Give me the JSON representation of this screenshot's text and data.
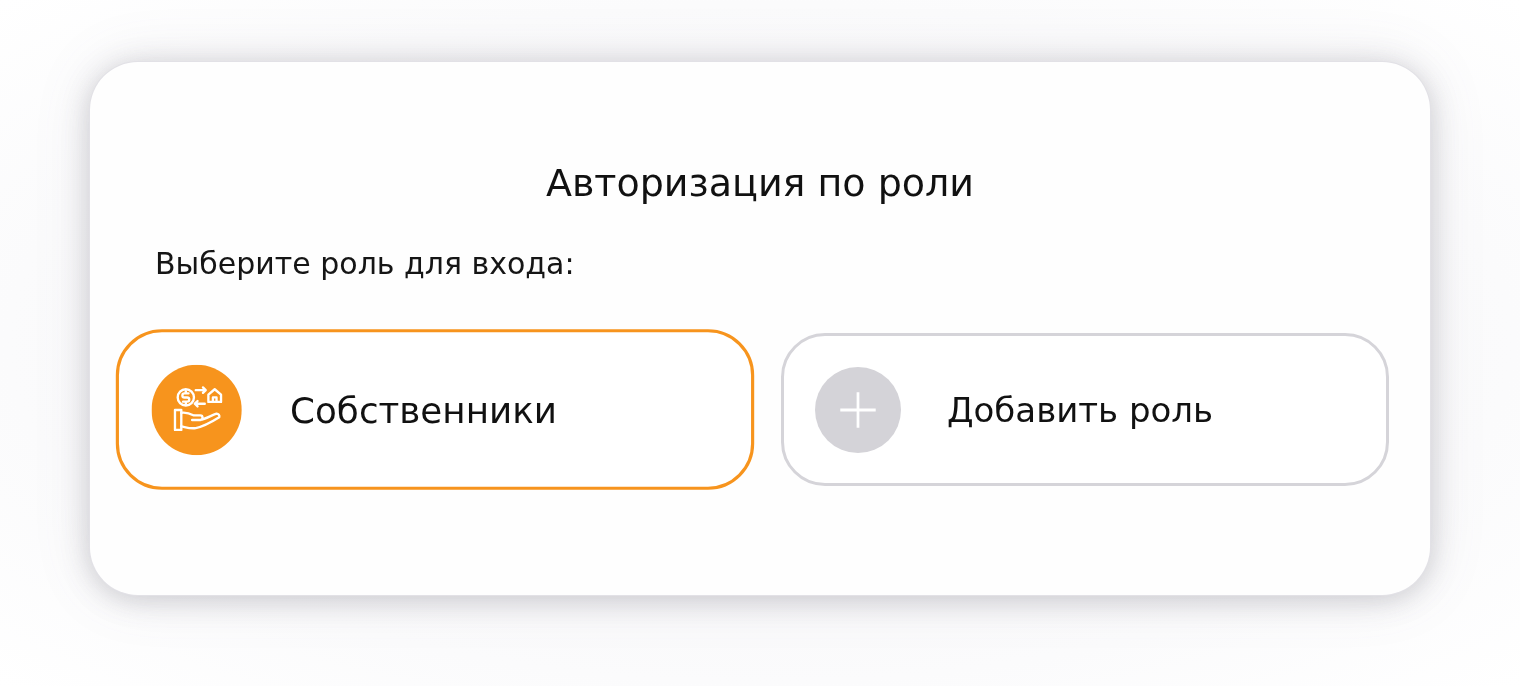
{
  "dialog": {
    "title": "Авторизация по роли",
    "subtitle": "Выберите роль для входа:"
  },
  "roles": [
    {
      "kind": "role",
      "label": "Собственники",
      "selected": true
    },
    {
      "kind": "add",
      "label": "Добавить роль",
      "selected": false
    }
  ]
}
